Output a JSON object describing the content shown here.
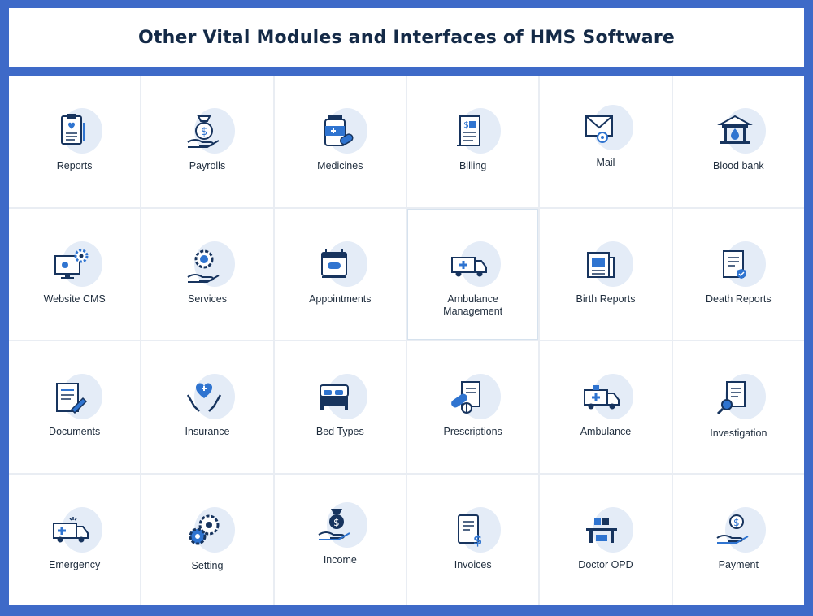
{
  "title": "Other Vital Modules and Interfaces of HMS Software",
  "colors": {
    "background": "#3e6ac8",
    "icon_primary": "#17345e",
    "icon_accent": "#2f74d0",
    "blob": "#e4ecf7"
  },
  "modules": [
    {
      "label": "Reports",
      "icon": "clipboard-heart-icon"
    },
    {
      "label": "Payrolls",
      "icon": "money-bag-hand-icon"
    },
    {
      "label": "Medicines",
      "icon": "medicine-bottle-icon"
    },
    {
      "label": "Billing",
      "icon": "bill-document-icon"
    },
    {
      "label": "Mail",
      "icon": "mail-envelope-icon"
    },
    {
      "label": "Blood bank",
      "icon": "blood-bank-building-icon"
    },
    {
      "label": "Website CMS",
      "icon": "monitor-gear-icon"
    },
    {
      "label": "Services",
      "icon": "gear-hand-icon"
    },
    {
      "label": "Appointments",
      "icon": "calendar-pills-icon"
    },
    {
      "label": "Ambulance\nManagement",
      "icon": "ambulance-icon"
    },
    {
      "label": "Birth Reports",
      "icon": "newspaper-icon"
    },
    {
      "label": "Death Reports",
      "icon": "document-check-icon"
    },
    {
      "label": "Documents",
      "icon": "document-pen-icon"
    },
    {
      "label": "Insurance",
      "icon": "heart-hands-icon"
    },
    {
      "label": "Bed Types",
      "icon": "bed-icon"
    },
    {
      "label": "Prescriptions",
      "icon": "prescription-capsule-icon"
    },
    {
      "label": "Ambulance",
      "icon": "ambulance-front-icon"
    },
    {
      "label": "Investigation",
      "icon": "document-magnifier-icon"
    },
    {
      "label": "Emergency",
      "icon": "emergency-van-icon"
    },
    {
      "label": "Setting",
      "icon": "gears-icon"
    },
    {
      "label": "Income",
      "icon": "coin-hand-icon"
    },
    {
      "label": "Invoices",
      "icon": "invoice-dollar-icon"
    },
    {
      "label": "Doctor OPD",
      "icon": "doctor-desk-icon"
    },
    {
      "label": "Payment",
      "icon": "coin-payment-hand-icon"
    }
  ]
}
